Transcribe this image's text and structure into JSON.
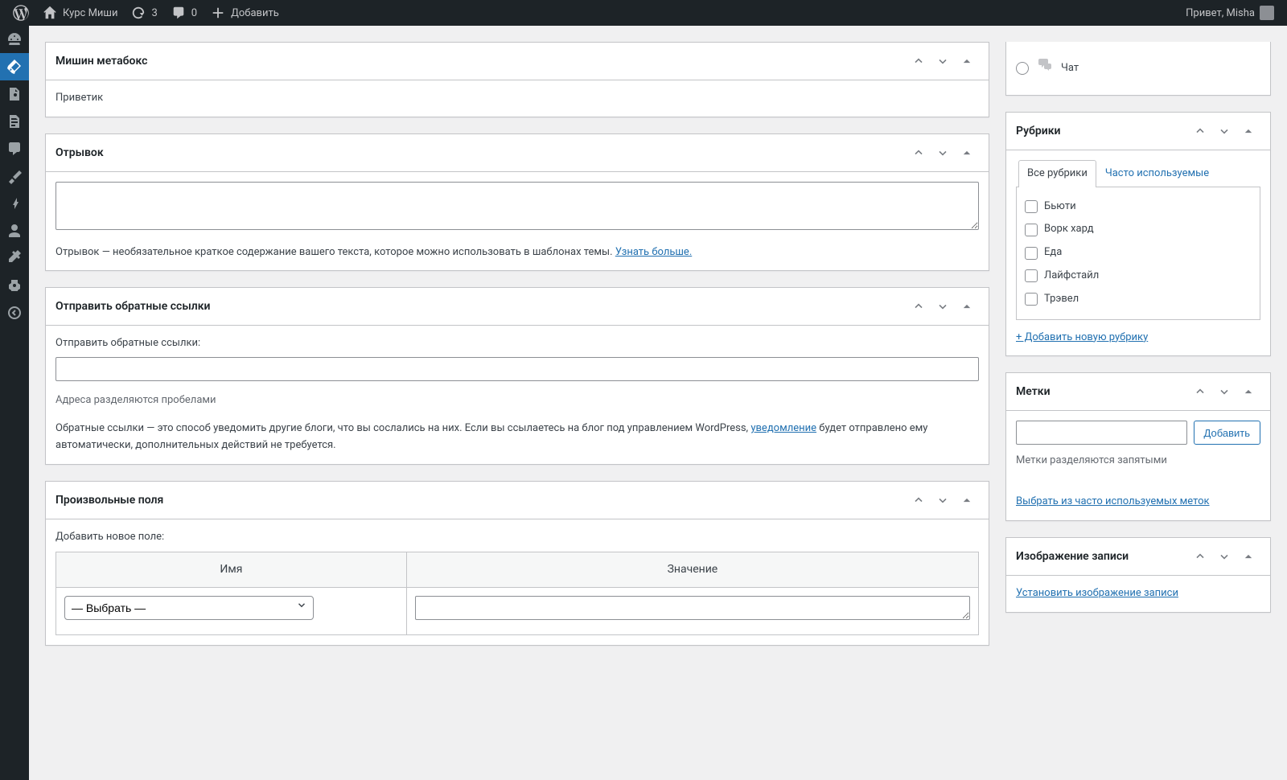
{
  "adminbar": {
    "site_title": "Курс Миши",
    "updates_count": "3",
    "comments_count": "0",
    "add_new_label": "Добавить",
    "howdy_prefix": "Привет,",
    "user_name": "Misha"
  },
  "sidebar_panel_chat": {
    "label": "Чат"
  },
  "metabox_custom": {
    "title": "Мишин метабокс",
    "content": "Приветик"
  },
  "metabox_excerpt": {
    "title": "Отрывок",
    "desc_pre": "Отрывок — необязательное краткое содержание вашего текста, которое можно использовать в шаблонах темы. ",
    "desc_link": "Узнать больше."
  },
  "metabox_trackbacks": {
    "title": "Отправить обратные ссылки",
    "label": "Отправить обратные ссылки:",
    "hint": "Адреса разделяются пробелами",
    "desc_p1": "Обратные ссылки — это способ уведомить другие блоги, что вы сослались на них. Если вы ссылаетесь на блог под управлением WordPress, ",
    "desc_link": "уведомление",
    "desc_p2": " будет отправлено ему автоматически, дополнительных действий не требуется."
  },
  "metabox_customfields": {
    "title": "Произвольные поля",
    "add_label": "Добавить новое поле:",
    "col_name": "Имя",
    "col_value": "Значение",
    "select_placeholder": "— Выбрать —"
  },
  "rubriki": {
    "title": "Рубрики",
    "tab_all": "Все рубрики",
    "tab_freq": "Часто используемые",
    "cats": [
      "Бьюти",
      "Ворк хард",
      "Еда",
      "Лайфстайл",
      "Трэвел"
    ],
    "add_link": "+ Добавить новую рубрику"
  },
  "tags": {
    "title": "Метки",
    "add_btn": "Добавить",
    "hint": "Метки разделяются запятыми",
    "freq_link": "Выбрать из часто используемых меток"
  },
  "featured": {
    "title": "Изображение записи",
    "set_link": "Установить изображение записи"
  }
}
